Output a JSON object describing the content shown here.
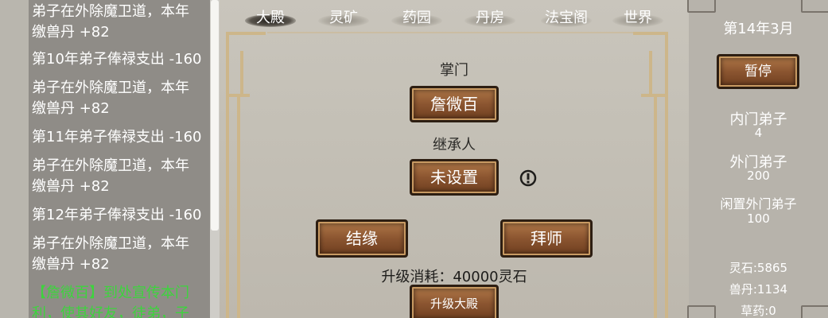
{
  "log": {
    "entries": [
      {
        "text": "弟子在外除魔卫道，本年",
        "color": "white"
      },
      {
        "text": "缴兽丹 +82",
        "color": "white"
      },
      {
        "text": "第10年弟子俸禄支出 -160",
        "color": "white"
      },
      {
        "text": "弟子在外除魔卫道，本年",
        "color": "white"
      },
      {
        "text": "缴兽丹 +82",
        "color": "white"
      },
      {
        "text": "第11年弟子俸禄支出 -160",
        "color": "white"
      },
      {
        "text": "弟子在外除魔卫道，本年",
        "color": "white"
      },
      {
        "text": "缴兽丹 +82",
        "color": "white"
      },
      {
        "text": "第12年弟子俸禄支出 -160",
        "color": "white"
      },
      {
        "text": "弟子在外除魔卫道，本年",
        "color": "white"
      },
      {
        "text": "缴兽丹 +82",
        "color": "white"
      },
      {
        "text": "【詹微百】到处宣传本门",
        "color": "green"
      },
      {
        "text": "利，使其好友，徒弟，子",
        "color": "green"
      }
    ]
  },
  "tabs": [
    {
      "label": "大殿",
      "active": true
    },
    {
      "label": "灵矿",
      "active": false
    },
    {
      "label": "药园",
      "active": false
    },
    {
      "label": "丹房",
      "active": false
    },
    {
      "label": "法宝阁",
      "active": false
    },
    {
      "label": "世界",
      "active": false
    }
  ],
  "hall": {
    "master_label": "掌门",
    "master_name": "詹微百",
    "successor_label": "继承人",
    "successor_value": "未设置",
    "warning_icon": "exclamation-circle-icon",
    "bond_button": "结缘",
    "apprentice_button": "拜师",
    "upgrade_cost": "升级消耗：40000灵石",
    "upgrade_button": "升级大殿"
  },
  "info": {
    "date": "第14年3月",
    "pause_button": "暂停",
    "inner_disciples_label": "内门弟子",
    "inner_disciples_value": "4",
    "outer_disciples_label": "外门弟子",
    "outer_disciples_value": "200",
    "idle_outer_label": "闲置外门弟子",
    "idle_outer_value": "100",
    "spirit_stone": "灵石:5865",
    "beast_pill": "兽丹:1134",
    "herbs": "草药:0"
  },
  "colors": {
    "log_text": "#ffffff",
    "log_highlight": "#3dd43d",
    "button_brown": "#8b5530",
    "frame_gold": "#cdb68a"
  }
}
